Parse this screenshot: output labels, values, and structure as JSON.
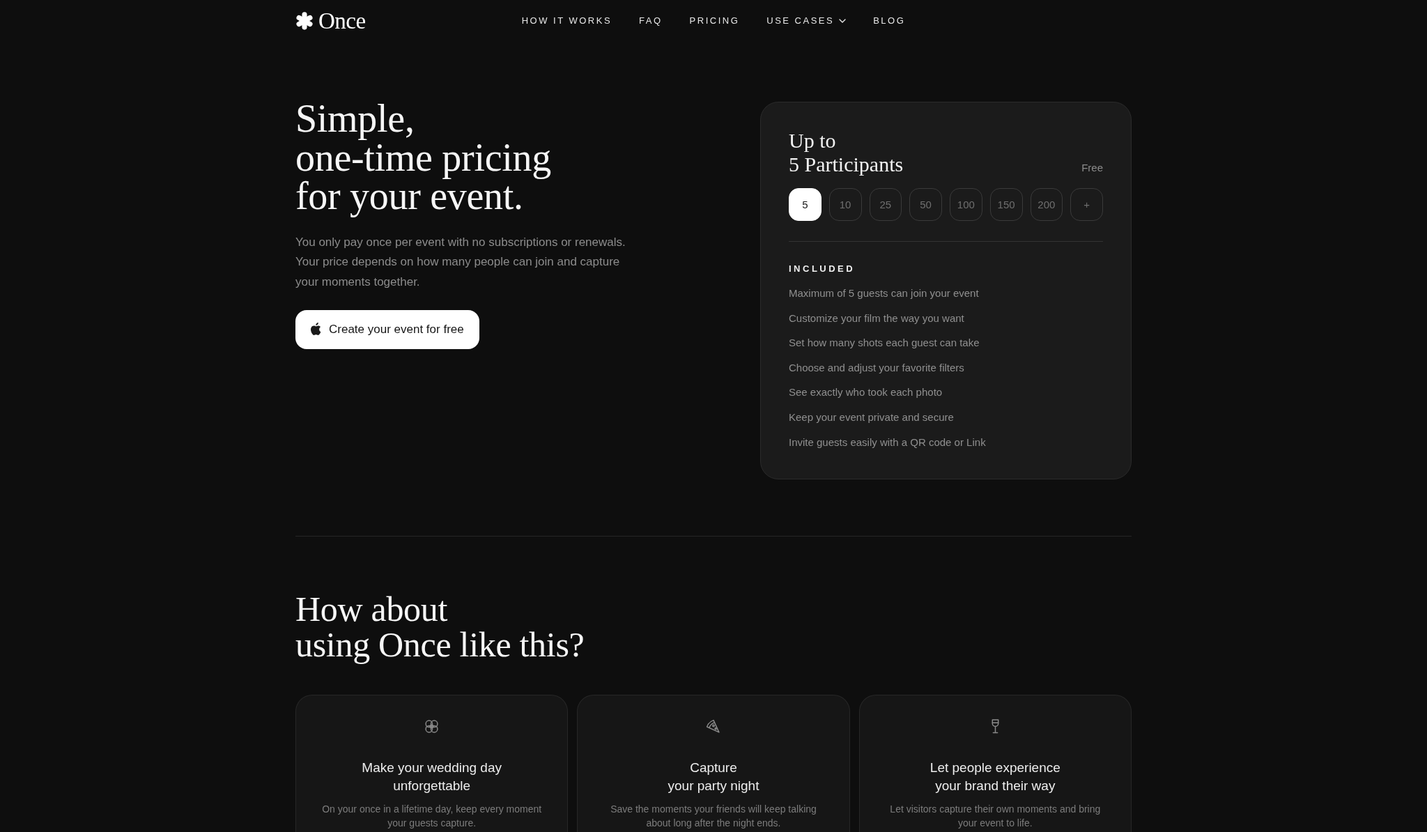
{
  "header": {
    "logo": "Once",
    "nav": [
      {
        "label": "HOW IT WORKS",
        "dropdown": false
      },
      {
        "label": "FAQ",
        "dropdown": false
      },
      {
        "label": "PRICING",
        "dropdown": false
      },
      {
        "label": "USE CASES",
        "dropdown": true
      },
      {
        "label": "BLOG",
        "dropdown": false
      }
    ]
  },
  "hero": {
    "title_lines": [
      "Simple,",
      "one-time pricing",
      "for your event."
    ],
    "description_lines": [
      "You only pay once per event with no subscriptions or renewals.",
      "Your price depends on how many people can join and capture",
      "your moments together."
    ],
    "cta": "Create your event for free"
  },
  "pricing": {
    "title_lines": [
      "Up to",
      "5 Participants"
    ],
    "price": "Free",
    "options": [
      {
        "label": "5",
        "selected": true
      },
      {
        "label": "10",
        "selected": false
      },
      {
        "label": "25",
        "selected": false
      },
      {
        "label": "50",
        "selected": false
      },
      {
        "label": "100",
        "selected": false
      },
      {
        "label": "150",
        "selected": false
      },
      {
        "label": "200",
        "selected": false
      },
      {
        "label": "+",
        "selected": false
      }
    ],
    "included_heading": "INCLUDED",
    "included": [
      "Maximum of 5 guests can join your event",
      "Customize your film the way you want",
      "Set how many shots each guest can take",
      "Choose and adjust your favorite filters",
      "See exactly who took each photo",
      "Keep your event private and secure",
      "Invite guests easily with a QR code or Link"
    ]
  },
  "use_cases": {
    "title_lines": [
      "How about",
      "using Once like this?"
    ],
    "cards": [
      {
        "title_lines": [
          "Make your wedding day",
          "unforgettable"
        ],
        "description_lines": [
          "On your once in a lifetime day, keep every moment",
          "your guests capture."
        ]
      },
      {
        "title_lines": [
          "Capture",
          "your party night"
        ],
        "description_lines": [
          "Save the moments your friends will keep talking",
          "about long after the night ends."
        ]
      },
      {
        "title_lines": [
          "Let people experience",
          "your brand their way"
        ],
        "description_lines": [
          "Let visitors capture their own moments and bring",
          "your event to life."
        ]
      }
    ]
  }
}
